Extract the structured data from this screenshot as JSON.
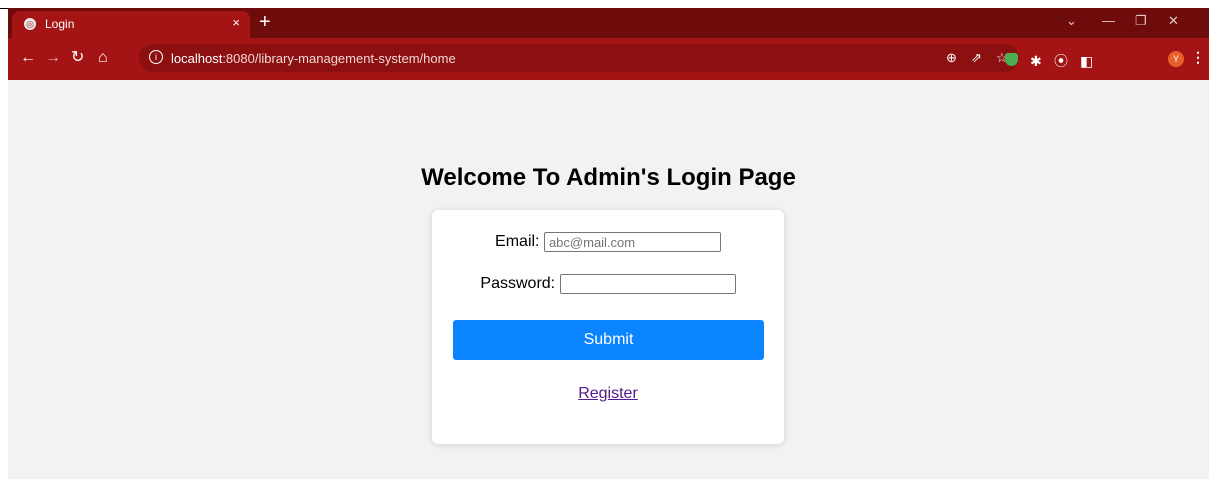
{
  "browser": {
    "tab_title": "Login",
    "tab_close": "×",
    "new_tab": "+",
    "url_host": "localhost",
    "url_rest": ":8080/library-management-system/home",
    "avatar_letter": "Y"
  },
  "page": {
    "heading": "Welcome To Admin's Login Page",
    "email_label": "Email:",
    "email_placeholder": "abc@mail.com",
    "password_label": "Password:",
    "password_value": "",
    "submit_label": "Submit",
    "register_label": "Register"
  },
  "colors": {
    "tabstrip": "#6e0b0b",
    "toolbar": "#a51414",
    "submit_button": "#0a84ff",
    "link": "#551a8b"
  }
}
